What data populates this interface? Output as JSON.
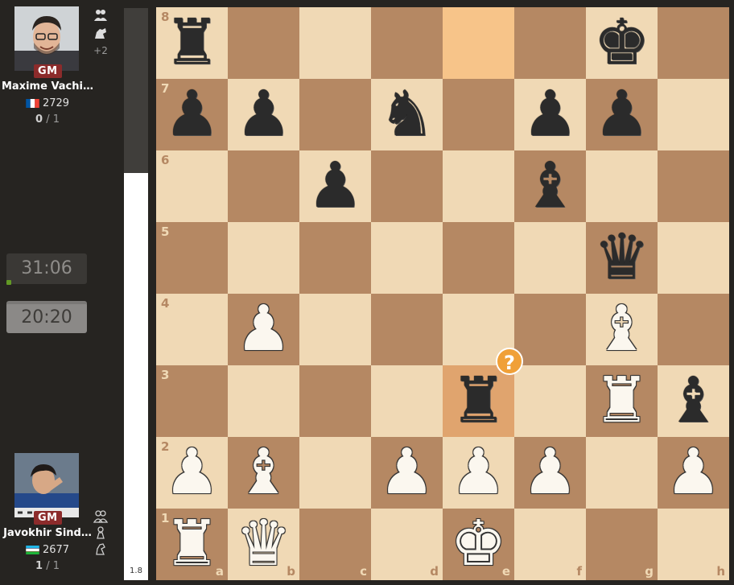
{
  "top_player": {
    "title": "GM",
    "name": "Maxime Vachi…",
    "rating": "2729",
    "score_main": "0",
    "score_rest": " / 1",
    "flag": "france",
    "extra_count": "+2"
  },
  "bottom_player": {
    "title": "GM",
    "name": "Javokhir Sind…",
    "rating": "2677",
    "score_main": "1",
    "score_rest": " / 1",
    "flag": "uzbekistan"
  },
  "clocks": {
    "top": "31:06",
    "bottom": "20:20"
  },
  "eval": {
    "value": "1.8",
    "white_share": 0.712
  },
  "board": {
    "orientation": "white",
    "highlight_squares": [
      "e8",
      "e3"
    ],
    "annotation": {
      "square": "e3",
      "symbol": "?"
    },
    "ranks": [
      "8",
      "7",
      "6",
      "5",
      "4",
      "3",
      "2",
      "1"
    ],
    "files": [
      "a",
      "b",
      "c",
      "d",
      "e",
      "f",
      "g",
      "h"
    ],
    "pieces": [
      {
        "sq": "a8",
        "p": "r"
      },
      {
        "sq": "g8",
        "p": "k"
      },
      {
        "sq": "a7",
        "p": "p"
      },
      {
        "sq": "b7",
        "p": "p"
      },
      {
        "sq": "d7",
        "p": "n"
      },
      {
        "sq": "f7",
        "p": "p"
      },
      {
        "sq": "g7",
        "p": "p"
      },
      {
        "sq": "c6",
        "p": "p"
      },
      {
        "sq": "f6",
        "p": "b"
      },
      {
        "sq": "g5",
        "p": "q"
      },
      {
        "sq": "b4",
        "p": "P"
      },
      {
        "sq": "g4",
        "p": "B"
      },
      {
        "sq": "e3",
        "p": "r"
      },
      {
        "sq": "g3",
        "p": "R"
      },
      {
        "sq": "h3",
        "p": "b"
      },
      {
        "sq": "a2",
        "p": "P"
      },
      {
        "sq": "b2",
        "p": "B"
      },
      {
        "sq": "d2",
        "p": "P"
      },
      {
        "sq": "e2",
        "p": "P"
      },
      {
        "sq": "f2",
        "p": "P"
      },
      {
        "sq": "h2",
        "p": "P"
      },
      {
        "sq": "a1",
        "p": "R"
      },
      {
        "sq": "b1",
        "p": "Q"
      },
      {
        "sq": "e1",
        "p": "K"
      }
    ]
  },
  "icons": {
    "top": [
      "players-icon",
      "horse-icon"
    ],
    "bottom": [
      "players-icon",
      "pawn-icon",
      "knight-icon"
    ]
  },
  "colors": {
    "light": "#f0d9b5",
    "dark": "#b58863",
    "highlight_light": "#f7c489",
    "highlight_dark": "#e0a46e",
    "badge": "#f0a038",
    "title_badge": "#8c2b2b"
  }
}
